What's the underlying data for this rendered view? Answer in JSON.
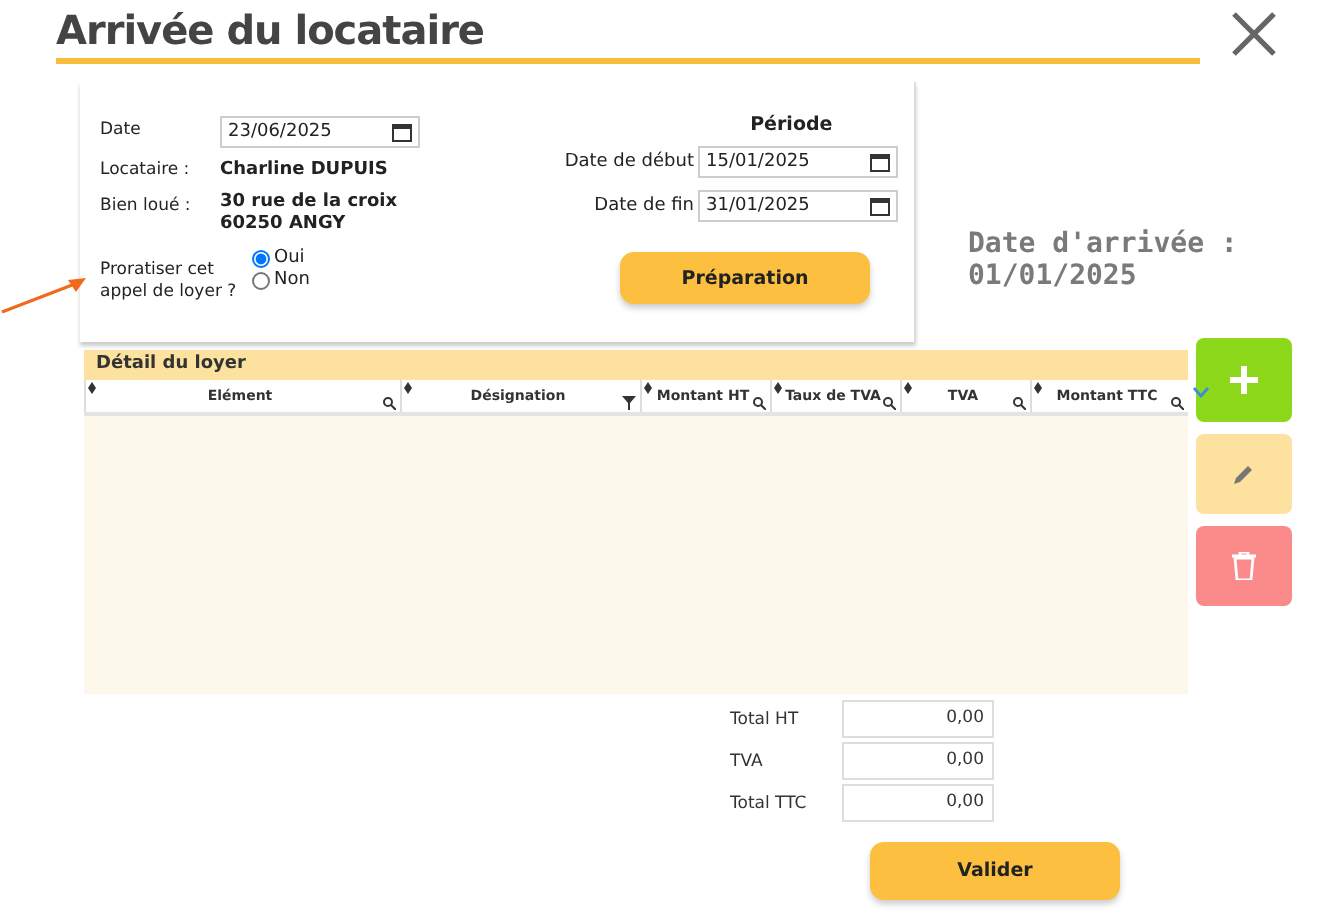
{
  "title": "Arrivée du locataire",
  "form": {
    "date": {
      "label": "Date",
      "value": "23/06/2025"
    },
    "tenant": {
      "label": "Locataire :",
      "value": "Charline DUPUIS"
    },
    "property": {
      "label": "Bien loué :",
      "lines": [
        "30 rue de la croix",
        "60250 ANGY"
      ]
    },
    "prorate": {
      "label": "Proratiser cet appel de loyer ?",
      "options": [
        {
          "label": "Oui",
          "selected": true
        },
        {
          "label": "Non",
          "selected": false
        }
      ]
    },
    "period": {
      "title": "Période",
      "start": {
        "label": "Date de début",
        "value": "15/01/2025"
      },
      "end": {
        "label": "Date de fin",
        "value": "31/01/2025"
      }
    },
    "prepare_button": "Préparation"
  },
  "arrival": {
    "label": "Date d'arrivée :",
    "value": "01/01/2025"
  },
  "table": {
    "title": "Détail du loyer",
    "columns": [
      {
        "label": "Elément",
        "kind": "search"
      },
      {
        "label": "Désignation",
        "kind": "filter"
      },
      {
        "label": "Montant HT",
        "kind": "search"
      },
      {
        "label": "Taux de TVA",
        "kind": "search"
      },
      {
        "label": "TVA",
        "kind": "search"
      },
      {
        "label": "Montant TTC",
        "kind": "search"
      }
    ]
  },
  "actions": [
    {
      "kind": "add"
    },
    {
      "kind": "edit"
    },
    {
      "kind": "delete"
    }
  ],
  "totals": [
    {
      "label": "Total HT",
      "value": "0,00"
    },
    {
      "label": "TVA",
      "value": "0,00"
    },
    {
      "label": "Total TTC",
      "value": "0,00"
    }
  ],
  "validate_button": "Valider"
}
